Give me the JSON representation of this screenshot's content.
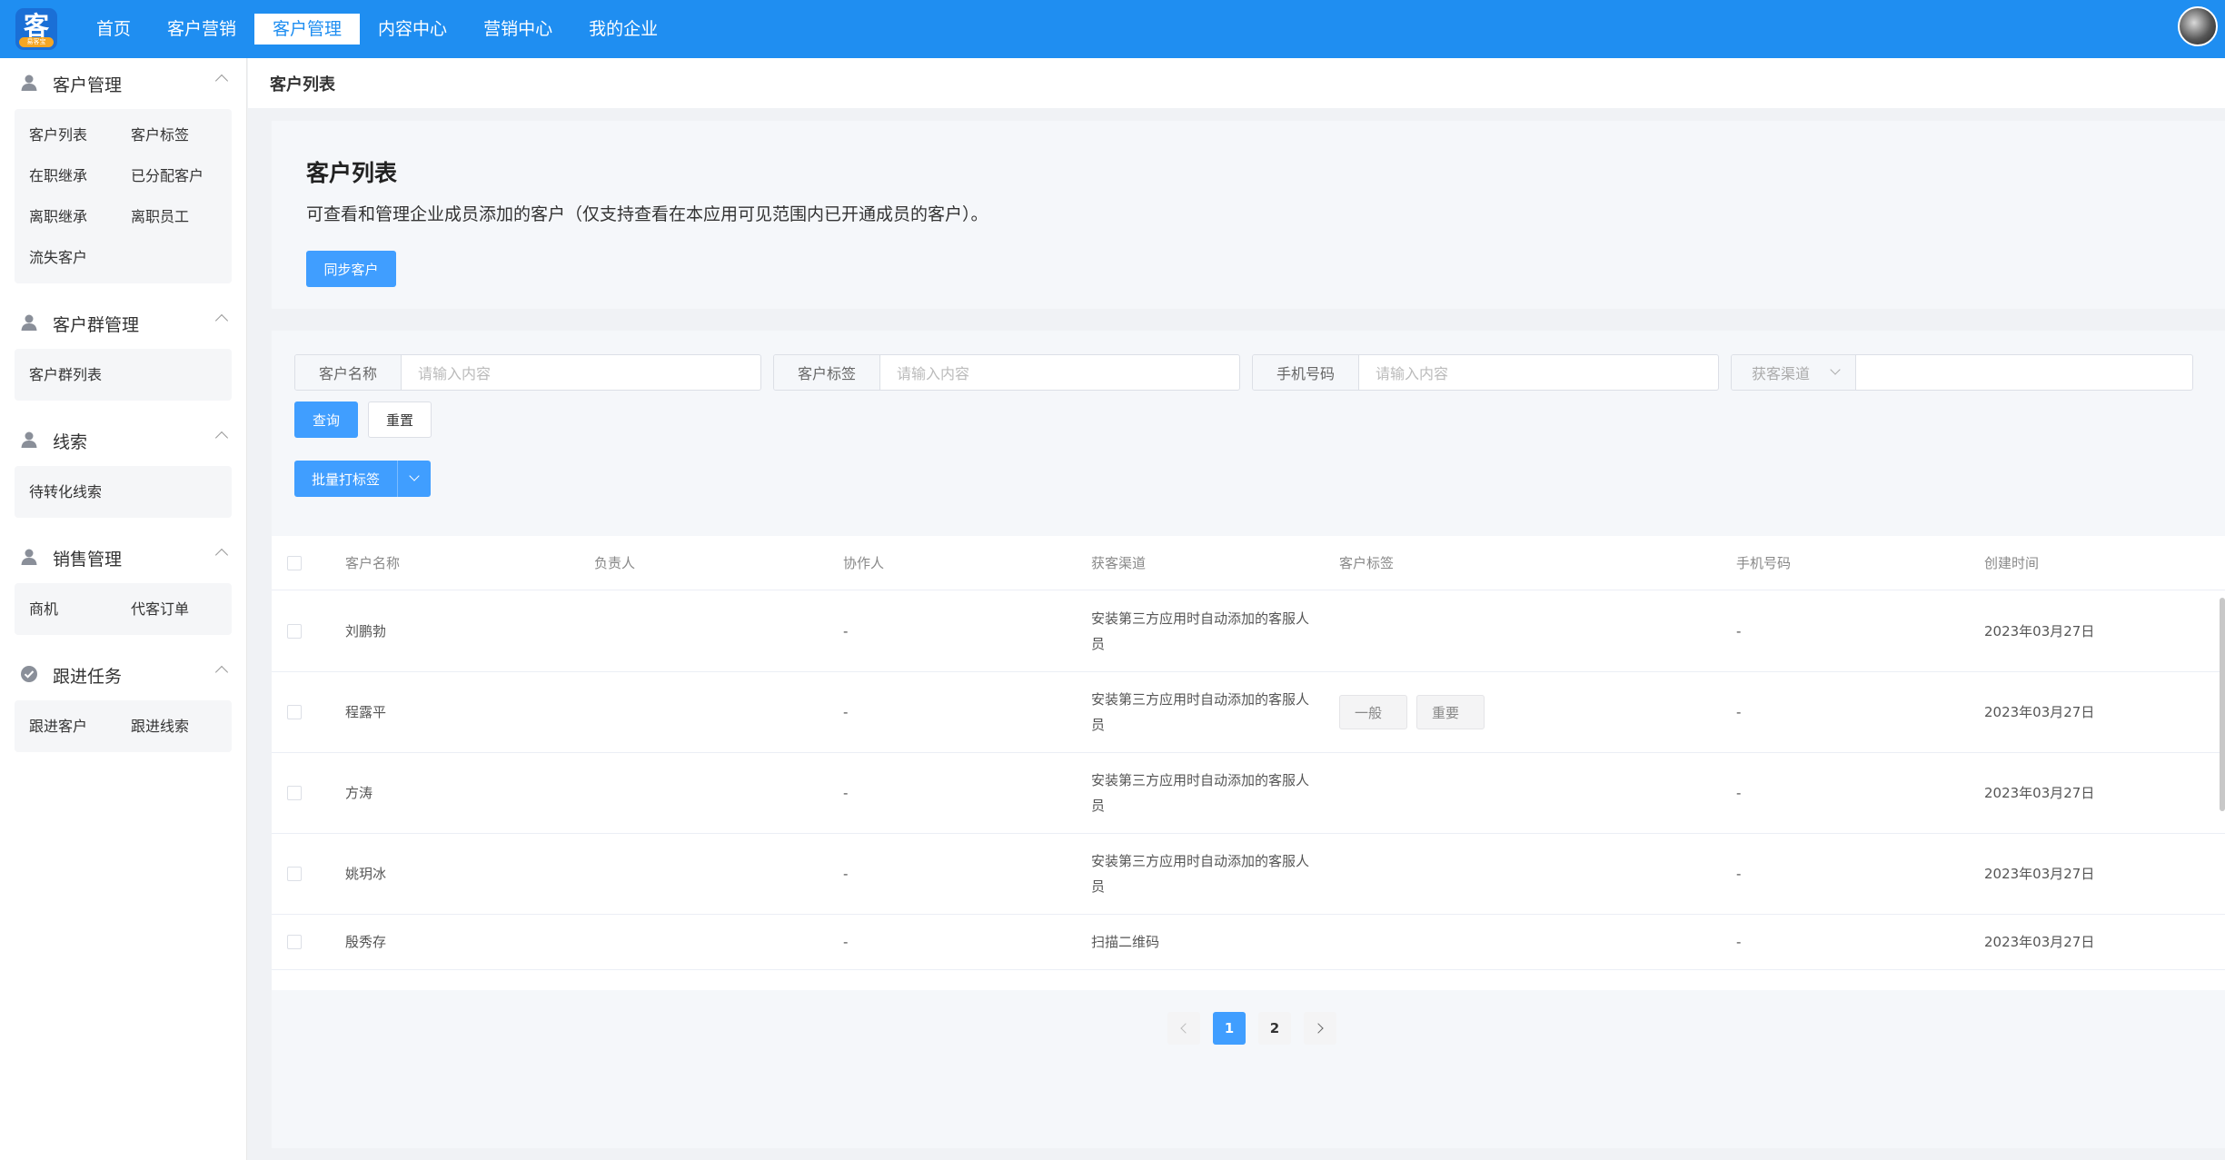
{
  "topbar": {
    "logo_text": "客",
    "logo_subtext": "易客宝",
    "nav": [
      "首页",
      "客户营销",
      "客户管理",
      "内容中心",
      "营销中心",
      "我的企业"
    ],
    "active_nav": 2
  },
  "sidebar": {
    "groups": [
      {
        "label": "客户管理",
        "icon": "user-icon",
        "items": [
          "客户列表",
          "客户标签",
          "在职继承",
          "已分配客户",
          "离职继承",
          "离职员工",
          "流失客户"
        ]
      },
      {
        "label": "客户群管理",
        "icon": "user-icon",
        "items": [
          "客户群列表"
        ]
      },
      {
        "label": "线索",
        "icon": "user-icon",
        "items": [
          "待转化线索"
        ]
      },
      {
        "label": "销售管理",
        "icon": "user-icon",
        "items": [
          "商机",
          "代客订单"
        ]
      },
      {
        "label": "跟进任务",
        "icon": "check-circle-icon",
        "items": [
          "跟进客户",
          "跟进线索"
        ]
      }
    ]
  },
  "breadcrumb": "客户列表",
  "intro": {
    "title": "客户列表",
    "description": "可查看和管理企业成员添加的客户（仅支持查看在本应用可见范围内已开通成员的客户）。",
    "sync_button": "同步客户"
  },
  "filters": {
    "customer_name": {
      "label": "客户名称",
      "placeholder": "请输入内容"
    },
    "customer_tag": {
      "label": "客户标签",
      "placeholder": "请输入内容"
    },
    "phone": {
      "label": "手机号码",
      "placeholder": "请输入内容"
    },
    "channel": {
      "label": "获客渠道",
      "placeholder": ""
    },
    "query_button": "查询",
    "reset_button": "重置",
    "batch_tag_button": "批量打标签"
  },
  "table": {
    "columns": [
      "客户名称",
      "负责人",
      "协作人",
      "获客渠道",
      "客户标签",
      "手机号码",
      "创建时间"
    ],
    "rows": [
      {
        "name": "刘鹏勃",
        "owner": "",
        "collaborator": "-",
        "channel_line1": "安装第三方应用时自动添加的客服人",
        "channel_line2": "员",
        "tags": [],
        "phone": "-",
        "created": "2023年03月27日"
      },
      {
        "name": "程露平",
        "owner": "",
        "collaborator": "-",
        "channel_line1": "安装第三方应用时自动添加的客服人",
        "channel_line2": "员",
        "tags": [
          "一般",
          "重要"
        ],
        "phone": "-",
        "created": "2023年03月27日"
      },
      {
        "name": "方涛",
        "owner": "",
        "collaborator": "-",
        "channel_line1": "安装第三方应用时自动添加的客服人",
        "channel_line2": "员",
        "tags": [],
        "phone": "-",
        "created": "2023年03月27日"
      },
      {
        "name": "姚玥冰",
        "owner": "",
        "collaborator": "-",
        "channel_line1": "安装第三方应用时自动添加的客服人",
        "channel_line2": "员",
        "tags": [],
        "phone": "-",
        "created": "2023年03月27日"
      },
      {
        "name": "殷秀存",
        "owner": "",
        "collaborator": "-",
        "channel_line1": "扫描二维码",
        "channel_line2": "",
        "tags": [],
        "phone": "-",
        "created": "2023年03月27日"
      }
    ]
  },
  "pagination": {
    "pages": [
      "1",
      "2"
    ],
    "current": "1"
  },
  "colors": {
    "primary": "#1f8ef1",
    "button": "#409eff",
    "panel": "#f5f7fa"
  }
}
